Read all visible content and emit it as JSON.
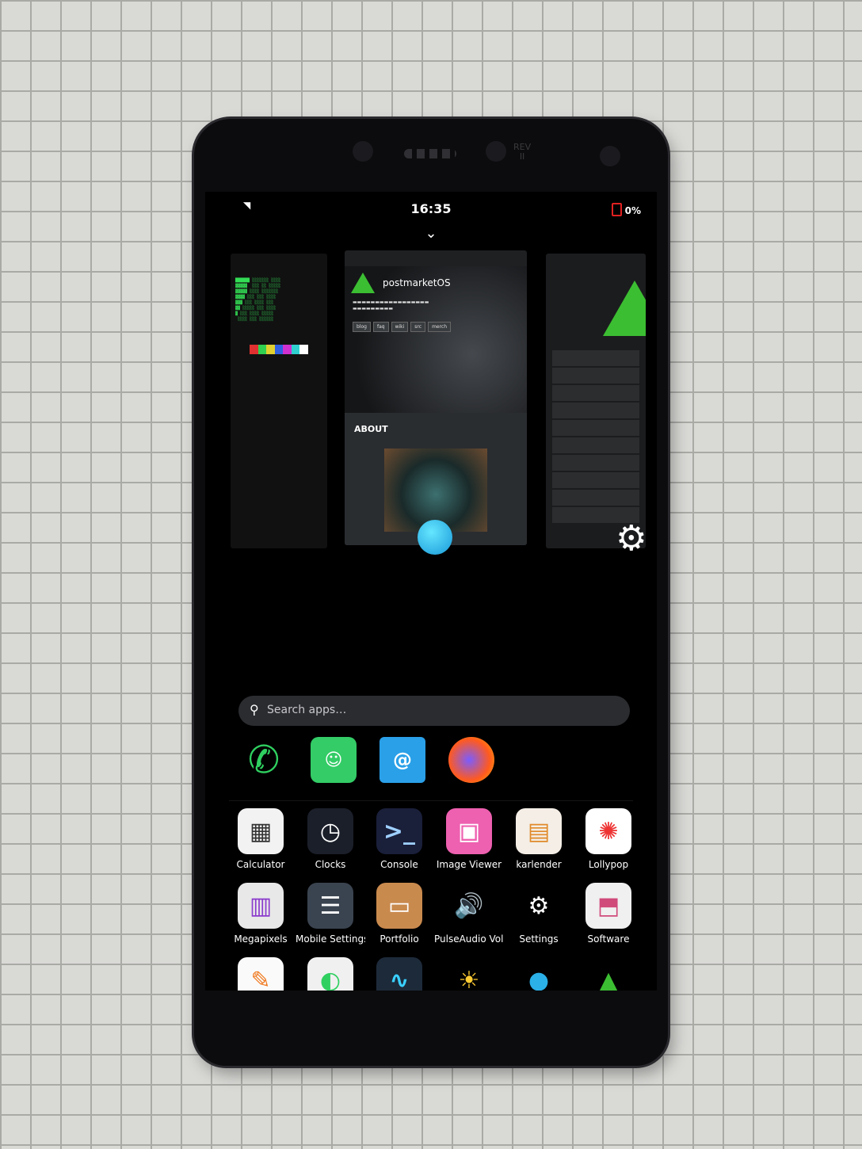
{
  "status": {
    "time": "16:35",
    "battery": "0%",
    "wifi_icon": "wifi-icon"
  },
  "switcher": {
    "center_title": "postmarketOS",
    "center_nav": [
      "blog",
      "faq",
      "wiki",
      "src",
      "merch"
    ],
    "center_about": "ABOUT"
  },
  "search": {
    "placeholder": "Search apps…"
  },
  "favorites": [
    {
      "name": "Phone",
      "icon": "phone-icon"
    },
    {
      "name": "Chats",
      "icon": "chat-icon"
    },
    {
      "name": "Contacts",
      "icon": "contacts-icon"
    },
    {
      "name": "Firefox",
      "icon": "firefox-icon"
    }
  ],
  "apps": [
    {
      "label": "Calculator",
      "icon": "calculator-icon",
      "color": "#f2f2f2"
    },
    {
      "label": "Clocks",
      "icon": "clock-icon",
      "color": "#1b1f2a"
    },
    {
      "label": "Console",
      "icon": "console-icon",
      "color": "#1a1f3a"
    },
    {
      "label": "Image Viewer",
      "icon": "image-icon",
      "color": "#ee60b0"
    },
    {
      "label": "karlender",
      "icon": "calendar-icon",
      "color": "#f4eee6"
    },
    {
      "label": "Lollypop",
      "icon": "lollypop-icon",
      "color": "#ffffff"
    },
    {
      "label": "Megapixels",
      "icon": "camera-icon",
      "color": "#e8e8e8"
    },
    {
      "label": "Mobile Settings",
      "icon": "mobile-settings-icon",
      "color": "#3a4450"
    },
    {
      "label": "Portfolio",
      "icon": "folder-icon",
      "color": "#c98a4e"
    },
    {
      "label": "PulseAudio Volume Control",
      "icon": "volume-icon",
      "color": "#000000"
    },
    {
      "label": "Settings",
      "icon": "gear-icon",
      "color": "#000000"
    },
    {
      "label": "Software",
      "icon": "software-icon",
      "color": "#f0f0f0"
    },
    {
      "label": "Text Editor",
      "icon": "text-editor-icon",
      "color": "#fafafa"
    },
    {
      "label": "Tweaks",
      "icon": "tweaks-icon",
      "color": "#f0f0f0"
    },
    {
      "label": "Usage",
      "icon": "usage-icon",
      "color": "#1d2a3a"
    },
    {
      "label": "Weather",
      "icon": "weather-icon",
      "color": "#000000"
    },
    {
      "label": "Web",
      "icon": "web-icon",
      "color": "#000000"
    },
    {
      "label": "Welcome",
      "icon": "welcome-icon",
      "color": "#000000"
    }
  ]
}
